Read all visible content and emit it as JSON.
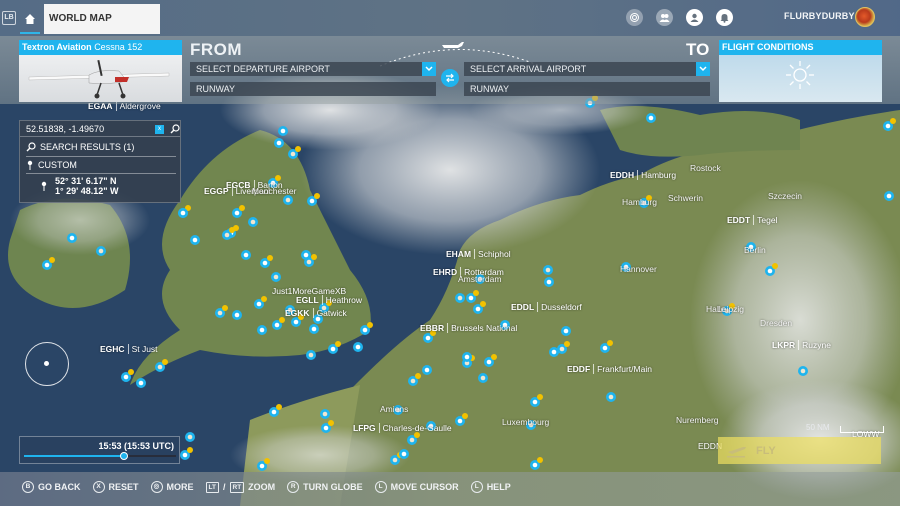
{
  "topbar": {
    "lb_label": "LB",
    "tab_label": "WORLD MAP",
    "icons": [
      "achievements-icon",
      "friends-icon",
      "profile-icon",
      "notifications-icon"
    ],
    "username": "FLURBYDURBY"
  },
  "aircraft": {
    "manufacturer": "Textron Aviation",
    "model": "Cessna 152"
  },
  "route": {
    "from_label": "FROM",
    "to_label": "TO",
    "departure_placeholder": "SELECT DEPARTURE AIRPORT",
    "arrival_placeholder": "SELECT ARRIVAL AIRPORT",
    "departure_runway": "RUNWAY",
    "arrival_runway": "RUNWAY"
  },
  "flight_conditions": {
    "title": "FLIGHT CONDITIONS",
    "weather": "sunny"
  },
  "search": {
    "value": "52.51838, -1.49670",
    "clear_label": "x",
    "results_label": "SEARCH RESULTS (1)",
    "result_category": "CUSTOM",
    "result_lat": "52° 31' 6.17\" N",
    "result_lon": "1° 29' 48.12\" W"
  },
  "time": {
    "label": "15:53 (15:53 UTC)",
    "progress": 0.66
  },
  "fly_label": "FLY",
  "scale_label": "50 NM",
  "hints": [
    {
      "button": "B",
      "label": "GO BACK"
    },
    {
      "button": "X",
      "label": "RESET"
    },
    {
      "button": "◎",
      "label": "MORE"
    },
    {
      "button": "LT",
      "button2": "RT",
      "label": "ZOOM"
    },
    {
      "button": "R",
      "label": "TURN GLOBE"
    },
    {
      "button": "L",
      "label": "MOVE CURSOR"
    },
    {
      "button": "L",
      "label": "HELP"
    }
  ],
  "map_labels": [
    {
      "code": "EGAA",
      "name": "Aldergrove"
    },
    {
      "code": "EGCB",
      "name": "Barton"
    },
    {
      "code": "EGGP",
      "name": "Liverpool"
    },
    {
      "code": "",
      "name": "Manchester"
    },
    {
      "code": "Just1MoreGameXB",
      "name": ""
    },
    {
      "code": "EGLL",
      "name": "Heathrow"
    },
    {
      "code": "EGKK",
      "name": "Gatwick"
    },
    {
      "code": "EGHC",
      "name": "St Just"
    },
    {
      "code": "EHAM",
      "name": "Schiphol"
    },
    {
      "code": "EHRD",
      "name": "Rotterdam"
    },
    {
      "code": "",
      "name": "Amsterdam"
    },
    {
      "code": "EDDL",
      "name": "Dusseldorf"
    },
    {
      "code": "EBBR",
      "name": "Brussels National"
    },
    {
      "code": "EDDH",
      "name": "Hamburg"
    },
    {
      "code": "",
      "name": "Rostock"
    },
    {
      "code": "",
      "name": "Schwerin"
    },
    {
      "code": "",
      "name": "Szczecin"
    },
    {
      "code": "EDDT",
      "name": "Tegel"
    },
    {
      "code": "",
      "name": "Hamburg"
    },
    {
      "code": "",
      "name": "Berlin"
    },
    {
      "code": "",
      "name": "Hannover"
    },
    {
      "code": "",
      "name": "Halle"
    },
    {
      "code": "",
      "name": "Leipzig"
    },
    {
      "code": "",
      "name": "Dresden"
    },
    {
      "code": "LKPR",
      "name": "Ruzyne"
    },
    {
      "code": "EDDF",
      "name": "Frankfurt/Main"
    },
    {
      "code": "",
      "name": "Nuremberg"
    },
    {
      "code": "EDDN",
      "name": ""
    },
    {
      "code": "LOWW",
      "name": ""
    },
    {
      "code": "",
      "name": "Amiens"
    },
    {
      "code": "LFPG",
      "name": "Charles-de-Gaulle"
    },
    {
      "code": "",
      "name": "Luxembourg"
    }
  ],
  "colors": {
    "accent": "#1fb4ee",
    "poi_badge": "#f2c200",
    "fly": "#ecde60"
  }
}
